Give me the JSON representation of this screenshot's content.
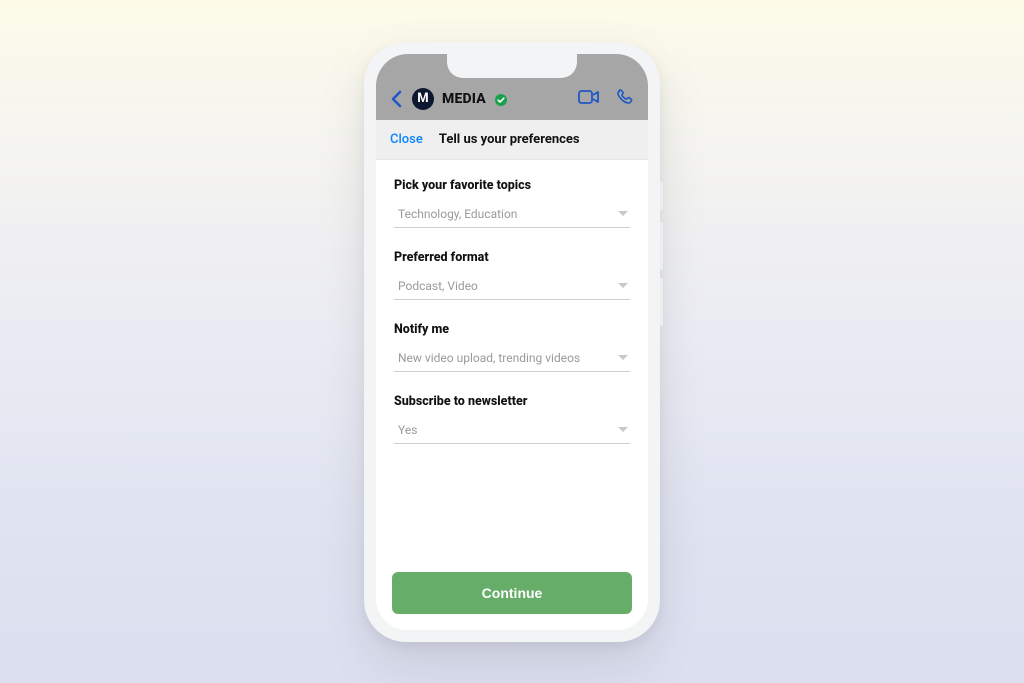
{
  "header": {
    "brand_letter": "M",
    "brand_name": "MEDIA"
  },
  "modal": {
    "close_label": "Close",
    "title": "Tell us your preferences"
  },
  "form": {
    "fields": [
      {
        "label": "Pick your favorite topics",
        "value": "Technology, Education"
      },
      {
        "label": "Preferred format",
        "value": "Podcast, Video"
      },
      {
        "label": "Notify me",
        "value": "New video upload, trending videos"
      },
      {
        "label": "Subscribe to newsletter",
        "value": "Yes"
      }
    ]
  },
  "footer": {
    "continue_label": "Continue"
  }
}
